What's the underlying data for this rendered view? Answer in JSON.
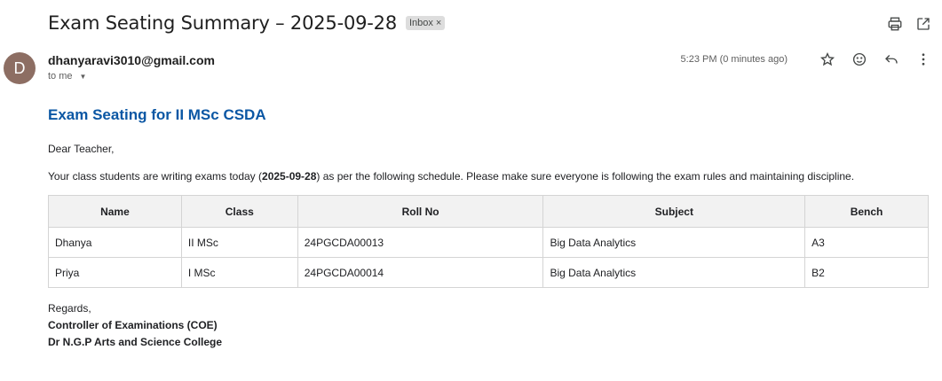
{
  "header": {
    "subject": "Exam Seating Summary – 2025-09-28",
    "label": "Inbox",
    "label_remove": "×"
  },
  "sender": {
    "initial": "D",
    "email": "dhanyaravi3010@gmail.com",
    "to": "to me",
    "timestamp": "5:23 PM (0 minutes ago)"
  },
  "icons": {
    "top": [
      "print-icon",
      "open-in-new-window-icon"
    ],
    "meta": [
      "star-icon",
      "emoji-react-icon",
      "reply-icon",
      "more-options-icon"
    ]
  },
  "colors": {
    "heading": "#0b57a4",
    "avatar": "#8d6e63",
    "table_header_bg": "#f2f2f2"
  },
  "email": {
    "heading": "Exam Seating for II MSc CSDA",
    "greeting": "Dear Teacher,",
    "intro_before": "Your class students are writing exams today (",
    "intro_date": "2025-09-28",
    "intro_after": ") as per the following schedule. Please make sure everyone is following the exam rules and maintaining discipline.",
    "table": {
      "headers": [
        "Name",
        "Class",
        "Roll No",
        "Subject",
        "Bench"
      ],
      "rows": [
        [
          "Dhanya",
          "II MSc",
          "24PGCDA00013",
          "Big Data Analytics",
          "A3"
        ],
        [
          "Priya",
          "I MSc",
          "24PGCDA00014",
          "Big Data Analytics",
          "B2"
        ]
      ]
    },
    "regards": "Regards,",
    "signature_line1": "Controller of Examinations (COE)",
    "signature_line2": "Dr N.G.P Arts and Science College"
  }
}
